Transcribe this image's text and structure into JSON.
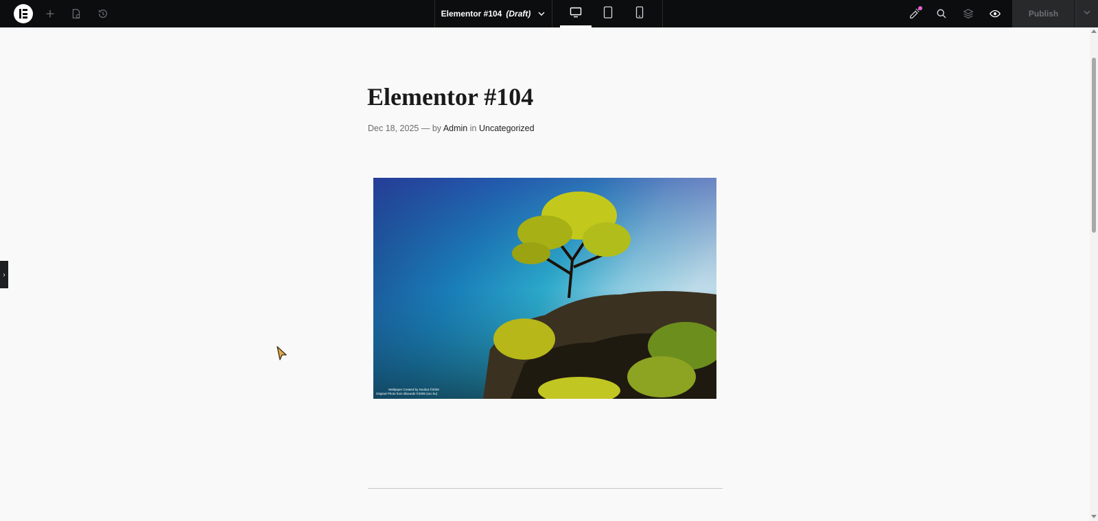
{
  "app": {
    "name": "Elementor"
  },
  "topbar": {
    "document_title": "Elementor #104",
    "document_status": "(Draft)",
    "publish_label": "Publish",
    "icons": [
      "elementor-logo-icon",
      "add-element-icon",
      "page-settings-icon",
      "history-icon",
      "chevron-down-icon",
      "desktop-icon",
      "tablet-icon",
      "mobile-icon",
      "whats-new-icon",
      "search-icon",
      "structure-icon",
      "preview-eye-icon",
      "chevron-down-icon"
    ],
    "active_device": "desktop",
    "notification_dot_color": "#ec5ed4"
  },
  "post": {
    "title": "Elementor #104",
    "date": "Dec 18, 2025",
    "separator": "—",
    "by_label": "by",
    "author": "Admin",
    "in_label": "in",
    "category": "Uncategorized",
    "image_caption_line1": "Wallpaper Created by Noobut ©2008",
    "image_caption_line2": "Original Photo from dbounds ©2006 (sxc.hu)"
  },
  "colors": {
    "topbar_bg": "#0c0d0e",
    "canvas_bg": "#f9f9f9",
    "publish_bg": "#27292b"
  }
}
